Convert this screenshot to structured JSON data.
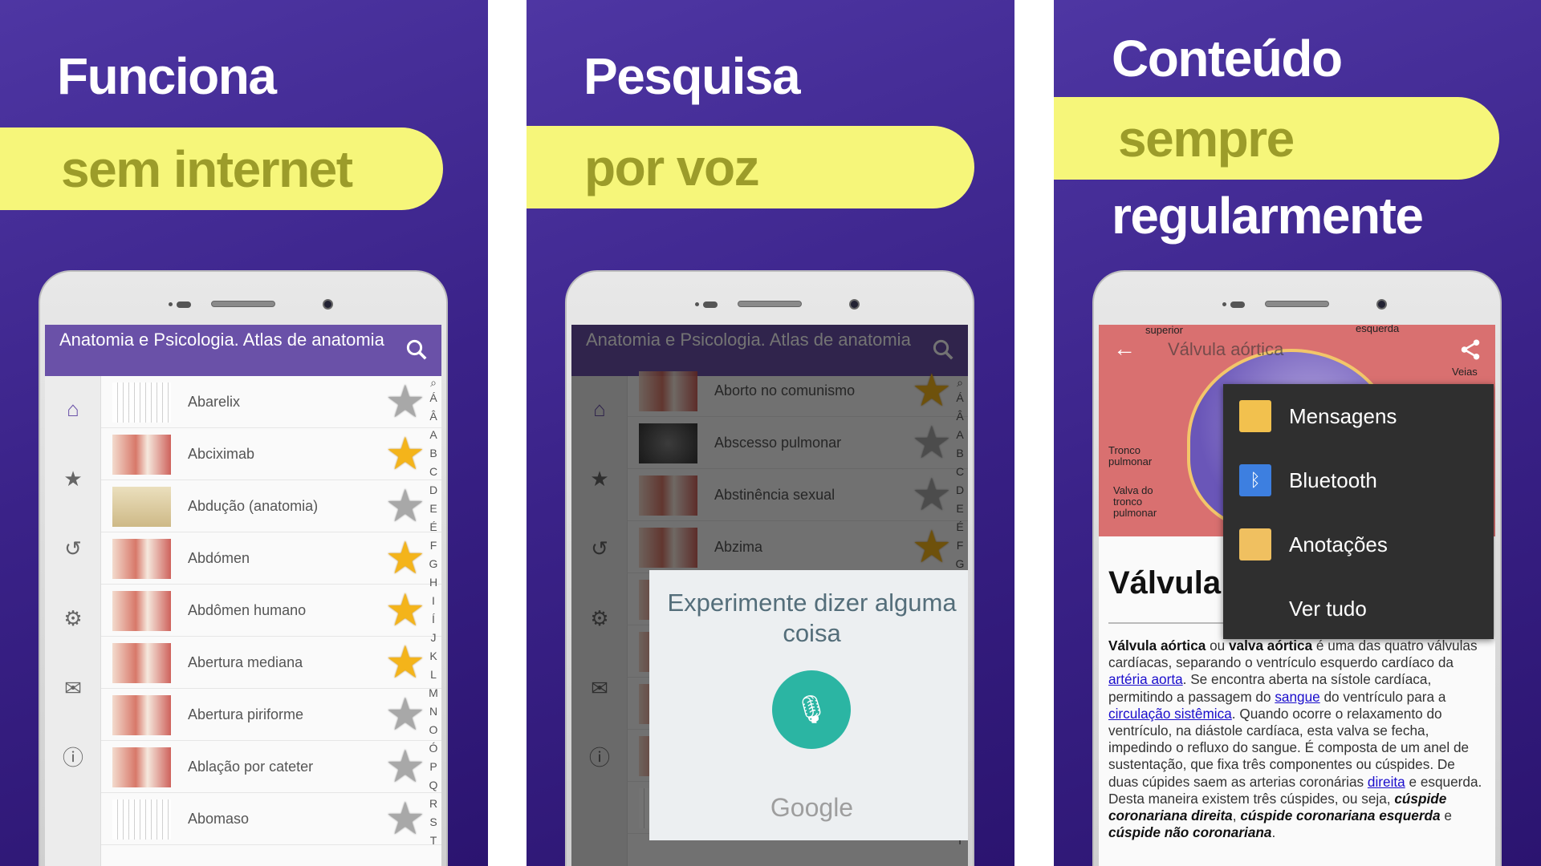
{
  "panels": [
    {
      "title": "Funciona",
      "highlight": "sem internet"
    },
    {
      "title": "Pesquisa",
      "highlight": "por voz"
    },
    {
      "title": "Conteúdo",
      "highlight": "sempre",
      "title2": "regularmente"
    }
  ],
  "app": {
    "title": "Anatomia e Psicologia. Atlas de anatomia"
  },
  "alphabet": [
    "Á",
    "Â",
    "A",
    "B",
    "C",
    "D",
    "E",
    "É",
    "F",
    "G",
    "H",
    "I",
    "Í",
    "J",
    "K",
    "L",
    "M",
    "N",
    "O",
    "Ó",
    "P",
    "Q",
    "R",
    "S",
    "T"
  ],
  "list1": [
    {
      "label": "Abarelix",
      "starred": false,
      "thumb": "w"
    },
    {
      "label": "Abciximab",
      "starred": true,
      "thumb": "b"
    },
    {
      "label": "Abdução (anatomia)",
      "starred": false,
      "thumb": "v"
    },
    {
      "label": "Abdómen",
      "starred": true,
      "thumb": "b"
    },
    {
      "label": "Abdômen humano",
      "starred": true,
      "thumb": "b"
    },
    {
      "label": "Abertura mediana",
      "starred": true,
      "thumb": "b"
    },
    {
      "label": "Abertura piriforme",
      "starred": false,
      "thumb": "b"
    },
    {
      "label": "Ablação por cateter",
      "starred": false,
      "thumb": "b"
    },
    {
      "label": "Abomaso",
      "starred": false,
      "thumb": "w"
    }
  ],
  "list2": [
    {
      "label": "Aborto no comunismo",
      "starred": true,
      "thumb": "b"
    },
    {
      "label": "Abscesso pulmonar",
      "starred": false,
      "thumb": "d"
    },
    {
      "label": "Abstinência sexual",
      "starred": false,
      "thumb": "b"
    },
    {
      "label": "Abzima",
      "starred": true,
      "thumb": "b"
    },
    {
      "label": "",
      "starred": false,
      "thumb": "b"
    },
    {
      "label": "",
      "starred": false,
      "thumb": "b"
    },
    {
      "label": "",
      "starred": false,
      "thumb": "b"
    },
    {
      "label": "",
      "starred": false,
      "thumb": "b"
    },
    {
      "label": "",
      "starred": false,
      "thumb": "w"
    }
  ],
  "voice": {
    "prompt": "Experimente dizer alguma coisa",
    "brand": "Google"
  },
  "article": {
    "title": "Válvula aórtica",
    "heading": "Válvula a",
    "image_labels": [
      "superior",
      "esquerda",
      "Tronco pulmonar",
      "Valva do tronco pulmonar",
      "Veias"
    ],
    "share_menu": [
      {
        "label": "Mensagens",
        "icon": "messages-icon",
        "color": "#f2c14e"
      },
      {
        "label": "Bluetooth",
        "icon": "bluetooth-icon",
        "color": "#3d7fe0"
      },
      {
        "label": "Anotações",
        "icon": "notes-icon",
        "color": "#f0c060"
      },
      {
        "label": "Ver tudo",
        "icon": "",
        "color": ""
      }
    ],
    "body": [
      {
        "t": "Válvula aórtica",
        "s": "b"
      },
      {
        "t": " ou "
      },
      {
        "t": "valva aórtica",
        "s": "b"
      },
      {
        "t": " é uma das quatro válvulas cardíacas, separando o ventrículo esquerdo cardíaco da "
      },
      {
        "t": "artéria aorta",
        "s": "a"
      },
      {
        "t": ". Se encontra aberta na sístole cardíaca, permitindo a passagem do "
      },
      {
        "t": "sangue",
        "s": "a"
      },
      {
        "t": " do ventrículo para a "
      },
      {
        "t": "circulação sistêmica",
        "s": "a"
      },
      {
        "t": ". Quando ocorre o relaxamento do ventrículo, na diástole cardíaca, esta valva se fecha, impedindo o refluxo do sangue. É composta de um anel de sustentação, que fixa três componentes ou cúspides. De duas cúpides saem as arterias coronárias "
      },
      {
        "t": "direita",
        "s": "a"
      },
      {
        "t": " e esquerda. Desta maneira existem três cúspides, ou seja, "
      },
      {
        "t": "cúspide coronariana direita",
        "s": "bi"
      },
      {
        "t": ", "
      },
      {
        "t": "cúspide coronariana esquerda",
        "s": "bi"
      },
      {
        "t": " e "
      },
      {
        "t": "cúspide não coronariana",
        "s": "bi"
      },
      {
        "t": "."
      }
    ]
  },
  "colors": {
    "appbar": "#6a51a8",
    "highlight": "#f6f67a",
    "highlight_text": "#9c9c2a",
    "star_gold": "#f4b41a",
    "mic": "#2bb5a3",
    "link": "#1a0dcc"
  }
}
